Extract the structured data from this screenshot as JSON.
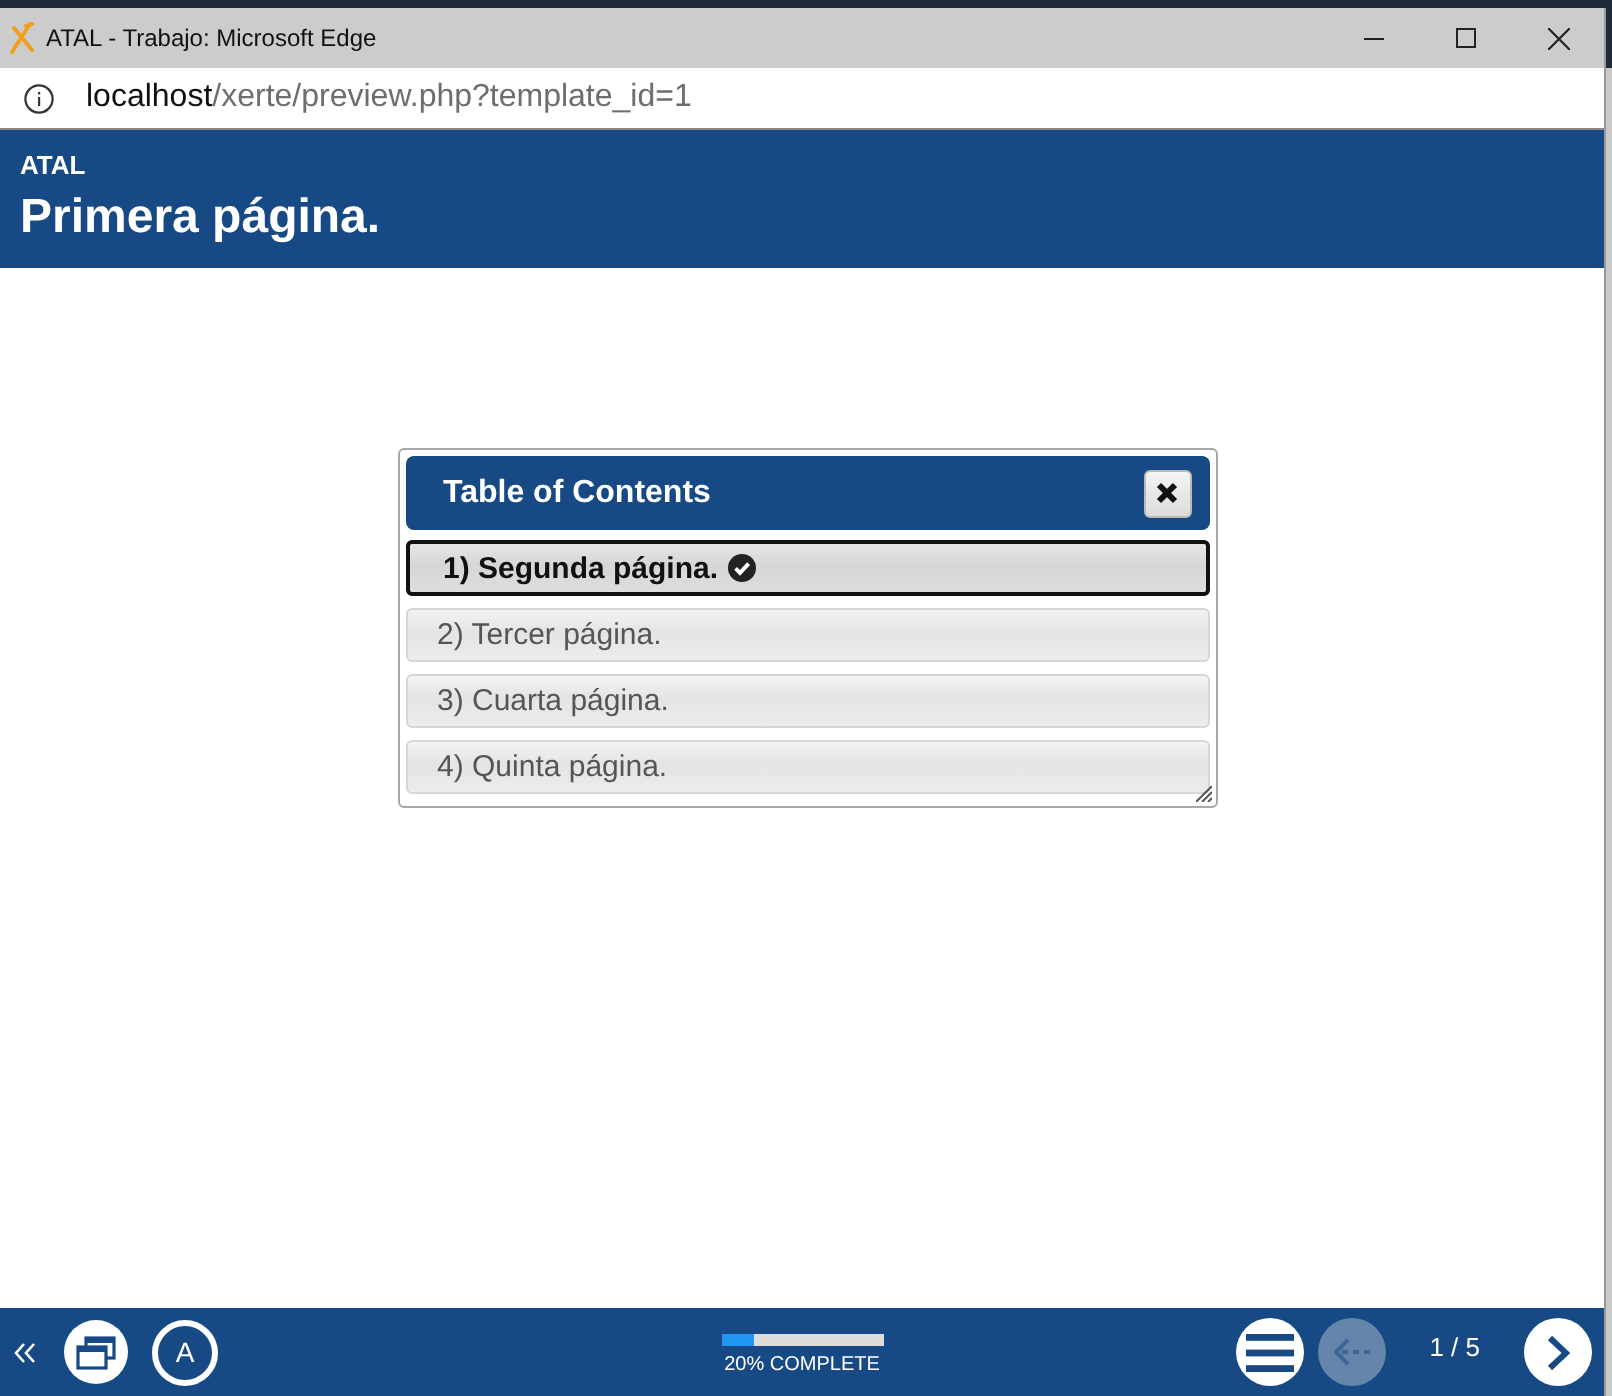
{
  "window": {
    "title": "ATAL - Trabajo: Microsoft Edge"
  },
  "address_bar": {
    "host": "localhost",
    "path": "/xerte/preview.php?template_id=1"
  },
  "header": {
    "project": "ATAL",
    "page_title": "Primera página."
  },
  "toc_dialog": {
    "title": "Table of Contents",
    "items": [
      {
        "label": "1) Segunda página.",
        "selected": true,
        "visited": true
      },
      {
        "label": "2) Tercer página.",
        "selected": false,
        "visited": false
      },
      {
        "label": "3) Cuarta página.",
        "selected": false,
        "visited": false
      },
      {
        "label": "4) Quinta página.",
        "selected": false,
        "visited": false
      }
    ]
  },
  "footer": {
    "accessibility_label": "A",
    "progress": {
      "level": 0.2,
      "label": "20% COMPLETE"
    },
    "back_disabled": true,
    "page_counter": "1 / 5"
  }
}
